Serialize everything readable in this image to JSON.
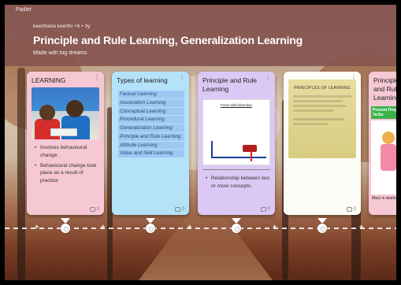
{
  "header": {
    "top_label": "Padlet",
    "author": "keerthana keerthi  +6  • 3y",
    "title": "Principle and Rule Learning, Generalization Learning",
    "subtitle": "Made with big dreams"
  },
  "cards": [
    {
      "title": "LEARNING",
      "bullets": [
        "Involves behavioural change.",
        "Behavioural change took place as a result of practice"
      ],
      "comments": "0"
    },
    {
      "title": "Types of learning",
      "items": [
        "Factual Learning",
        "Association Learning",
        "Conceptual Learning",
        "Procedural Learning",
        "Generalization Learning",
        "Principle and Rule Learning",
        "Attitude Learning",
        "Value and Skill Learning"
      ],
      "comments": "0"
    },
    {
      "title": "Principle and Rule Learning",
      "diagram_title": "Force with Direction",
      "bullets": [
        "Relationship between two or more concepts."
      ],
      "comments": "0"
    },
    {
      "title": "",
      "image_title": "PRINCIPLES OF LEARNING",
      "comments": "0"
    },
    {
      "title": "Principle and Rule Learning",
      "banner": "Present Progressive Verbs",
      "caption": "Mary is skating",
      "comments": "0"
    }
  ],
  "colors": {
    "header_bg": "#87564f",
    "card_pink": "#f6c8d4",
    "card_blue": "#b4e2f8",
    "card_purple": "#dcc8f4",
    "card_white": "#fdfdf7"
  }
}
